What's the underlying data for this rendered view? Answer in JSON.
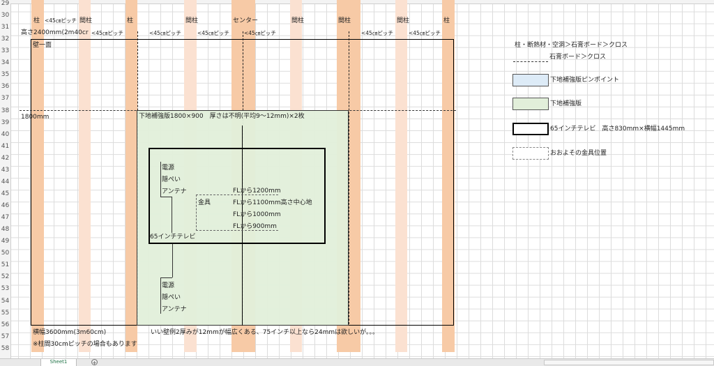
{
  "rows": [
    "29",
    "30",
    "31",
    "32",
    "33",
    "34",
    "35",
    "36",
    "37",
    "38",
    "39",
    "40",
    "41",
    "42",
    "43",
    "44",
    "45",
    "46",
    "47",
    "48",
    "49",
    "50",
    "51",
    "52",
    "53",
    "54",
    "55",
    "56",
    "57",
    "58"
  ],
  "header_row": {
    "hashira1": "柱",
    "pitch1": "<45㎝ピッチ",
    "mabashira1": "間柱",
    "hashira2": "柱",
    "mabashira2": "間柱",
    "center": "センター",
    "mabashira3": "間柱",
    "mabashira4": "間柱",
    "mabashira5": "間柱",
    "hashira3": "柱"
  },
  "row31": {
    "height": "高さ2400mm(2m40cr",
    "pitches": [
      "<45㎝ピッチ",
      "<45㎝ピッチ",
      "<45㎝ピッチ",
      "<45㎝ピッチ",
      "<45㎝ピッチ",
      "<45㎝ピッチ"
    ]
  },
  "wall": {
    "label": "壁一面",
    "height_mark": "1800mm",
    "width": "横幅3600mm(3m60cm)",
    "note_pitch": "※柱間30cmピッチの場合もあります",
    "comment": "いい壁例2厚みが12mmが幅広くある、75インチ以上なら24mmは欲しいが。。。"
  },
  "board": {
    "label": "下地補強版1800×900　厚さは不明(平均9～12mm)×2枚"
  },
  "tv": {
    "label": "65インチテレビ"
  },
  "outlets_top": [
    "電源",
    "隠ぺい",
    "アンテナ"
  ],
  "outlets_bottom": [
    "電源",
    "隠ぺい",
    "アンテナ"
  ],
  "kanagu": "金具",
  "fl_heights": [
    "FLから1200mm",
    "FLから1100mm高さ中心地",
    "FLから1000mm",
    "FLから900mm"
  ],
  "legend": {
    "line1": "柱・断熱材・空洞＞石膏ボード＞クロス",
    "line2": "石膏ボード＞クロス",
    "pinpoint": "下地補強版ピンポイント",
    "board": "下地補強版",
    "tv": "65インチテレビ　高さ830mm×横幅1445mm",
    "kanagu": "おおよその金具位置"
  },
  "colors": {
    "stud": "#f7caa6",
    "intermediate": "#fbe1d1",
    "board_fill": "#e2efda",
    "pinpoint_fill": "#ddebf7"
  },
  "sheet_tab": "Sheet1",
  "new_sheet": "+"
}
